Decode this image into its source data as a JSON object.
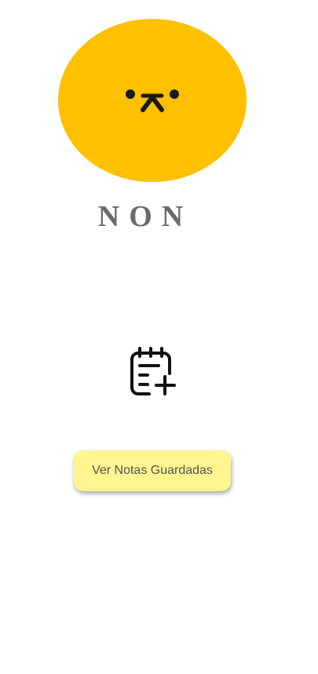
{
  "brand": {
    "title": "NON",
    "logo_color": "#FFC000"
  },
  "actions": {
    "add_note_icon": "notepad-plus-icon",
    "view_notes_label": "Ver Notas Guardadas",
    "view_notes_color": "#FFF68F"
  }
}
